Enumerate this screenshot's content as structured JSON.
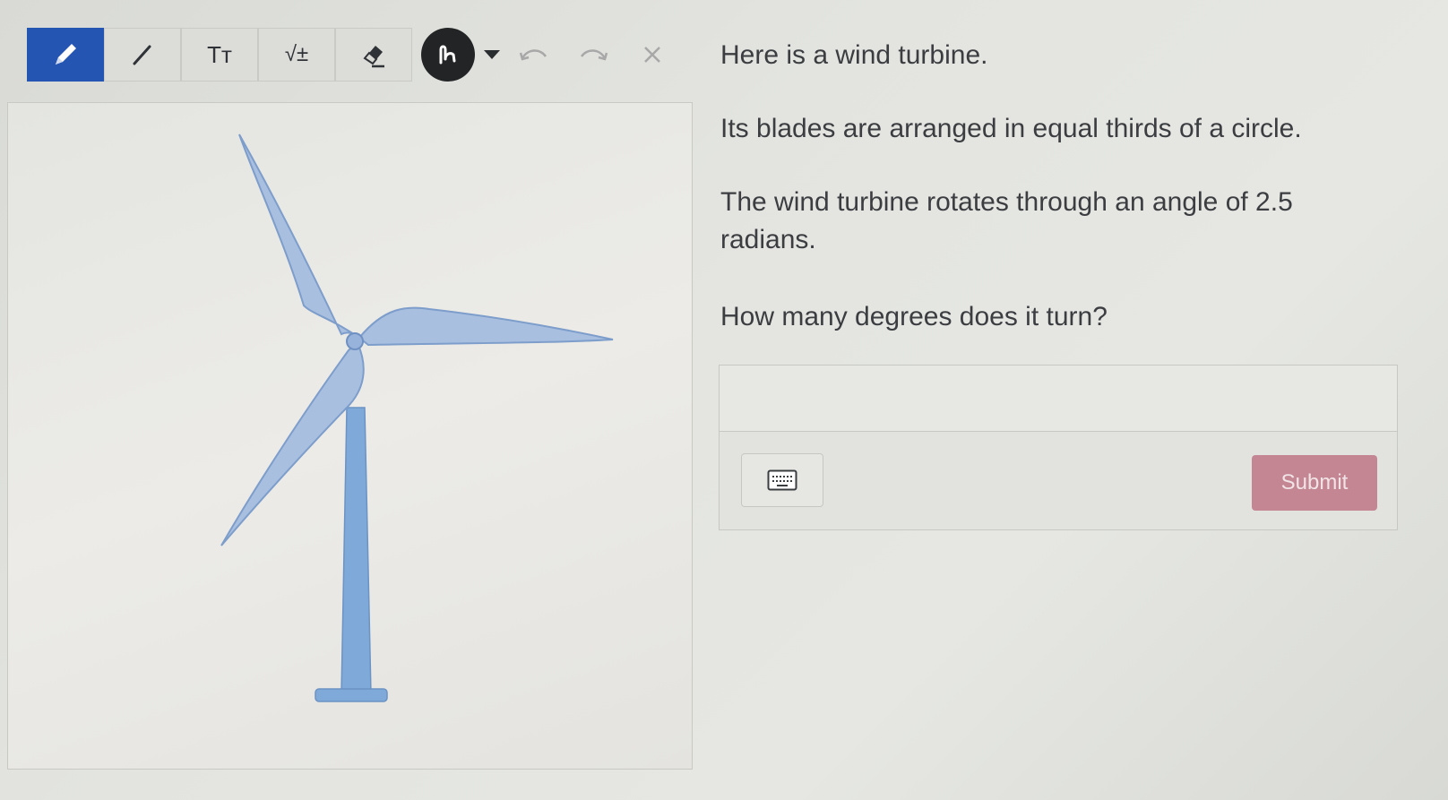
{
  "toolbar": {
    "tools": [
      {
        "name": "pen-icon",
        "active": true
      },
      {
        "name": "line-icon",
        "active": false
      },
      {
        "name": "text-size-icon",
        "active": false,
        "label": "Tт"
      },
      {
        "name": "square-root-icon",
        "active": false,
        "label": "√±"
      },
      {
        "name": "eraser-icon",
        "active": false
      }
    ],
    "color": "#222426",
    "undo_icon": "undo-icon",
    "redo_icon": "redo-icon",
    "clear_icon": "close-icon"
  },
  "question": {
    "line1": "Here is a wind turbine.",
    "line2": "Its blades are arranged in equal thirds of a circle.",
    "line3a": "The wind turbine rotates through an angle of 2.5",
    "line3b": "radians.",
    "line4": "How many degrees does it turn?"
  },
  "answer": {
    "value": "",
    "placeholder": ""
  },
  "keyboard_icon": "keyboard-icon",
  "submit_label": "Submit",
  "colors": {
    "accent": "#2455b3",
    "submit": "#c48693",
    "turbine": "#9cb5d8",
    "tower": "#7fa9d9"
  }
}
